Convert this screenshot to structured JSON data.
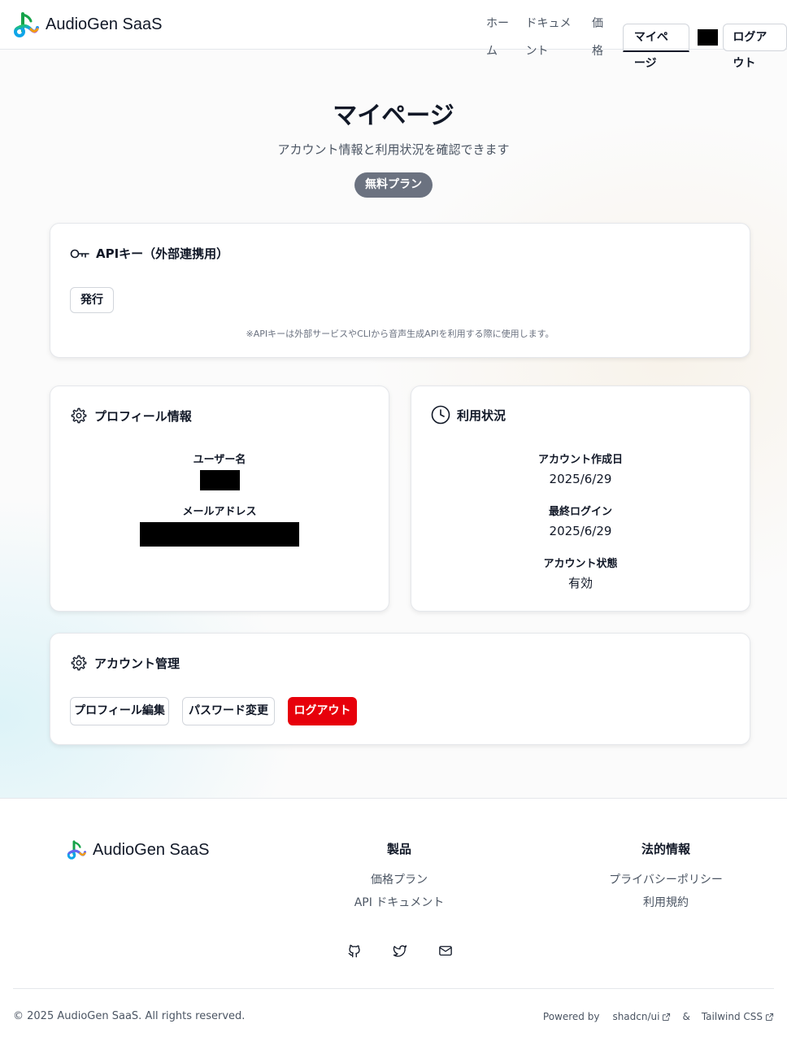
{
  "header": {
    "brand": "AudioGen SaaS",
    "nav": {
      "home": "ホーム",
      "docs": "ドキュメント",
      "pricing": "価格",
      "mypage": "マイページ",
      "logout": "ログアウト"
    }
  },
  "hero": {
    "title": "マイページ",
    "subtitle": "アカウント情報と利用状況を確認できます",
    "plan_badge": "無料プラン"
  },
  "api_card": {
    "title": "APIキー（外部連携用）",
    "issue_button": "発行",
    "note": "※APIキーは外部サービスやCLIから音声生成APIを利用する際に使用します。"
  },
  "profile_card": {
    "title": "プロフィール情報",
    "username_label": "ユーザー名",
    "email_label": "メールアドレス"
  },
  "usage_card": {
    "title": "利用状況",
    "created_label": "アカウント作成日",
    "created_value": "2025/6/29",
    "last_login_label": "最終ログイン",
    "last_login_value": "2025/6/29",
    "status_label": "アカウント状態",
    "status_value": "有効"
  },
  "account_card": {
    "title": "アカウント管理",
    "edit_profile": "プロフィール編集",
    "change_password": "パスワード変更",
    "logout": "ログアウト"
  },
  "footer": {
    "brand": "AudioGen SaaS",
    "product": {
      "heading": "製品",
      "links": [
        "価格プラン",
        "API ドキュメント"
      ]
    },
    "legal": {
      "heading": "法的情報",
      "links": [
        "プライバシーポリシー",
        "利用規約"
      ]
    },
    "social_icons": [
      "github-icon",
      "twitter-icon",
      "mail-icon"
    ],
    "copyright": "© 2025 AudioGen SaaS. All rights reserved.",
    "powered_by": "Powered by",
    "shadcn": "shadcn/ui",
    "amp": "&",
    "tailwind": "Tailwind CSS"
  },
  "colors": {
    "danger": "#e7000b",
    "badge": "#6b7280",
    "text": "#111827"
  }
}
